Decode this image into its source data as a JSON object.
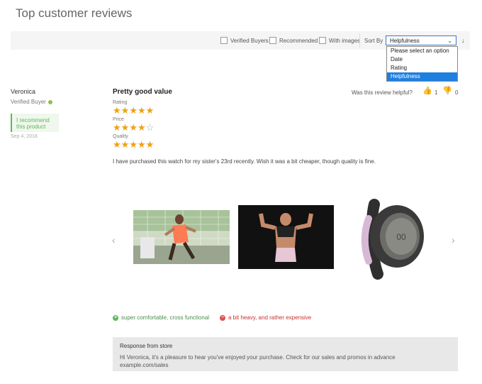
{
  "page": {
    "title": "Top customer reviews"
  },
  "filters": [
    {
      "label": "Verified Buyers",
      "checked": false
    },
    {
      "label": "Recommended",
      "checked": false
    },
    {
      "label": "With images",
      "checked": false
    }
  ],
  "sort": {
    "label": "Sort By",
    "selected": "Helpfulness",
    "options": [
      "Please select an option",
      "Date",
      "Rating",
      "Helpfulness"
    ],
    "highlighted_index": 3
  },
  "review": {
    "reviewer": "Veronica",
    "verified": "Verified Buyer",
    "recommend_line1": "I recommend",
    "recommend_line2": "this product",
    "date": "Sep 4, 2018",
    "title": "Pretty good value",
    "helpful_text": "Was this review helpful?",
    "helpful_up": "1",
    "helpful_down": "0",
    "ratings": [
      {
        "label": "Rating",
        "value": 5,
        "max": 5
      },
      {
        "label": "Price",
        "value": 4,
        "max": 5
      },
      {
        "label": "Quality",
        "value": 5,
        "max": 5
      }
    ],
    "text": "I have purchased this watch for my sister's 23rd recently. Wish it was a bit cheaper, though quality is fine.",
    "pros": "super comfortable, cross functional",
    "cons": "a bit heavy, and rather expensive"
  },
  "response": {
    "title": "Response from store",
    "line1": "Hi Veronica, it's a pleasure to hear you've enjoyed your purchase. Check for our sales and promos in advance",
    "line2": "example.com/sales"
  },
  "colors": {
    "star": "#f0a010",
    "accent_green": "#5cb85c",
    "accent_red": "#d9534f",
    "select_border": "#3b76c4",
    "dropdown_highlight": "#1e7fe0"
  }
}
